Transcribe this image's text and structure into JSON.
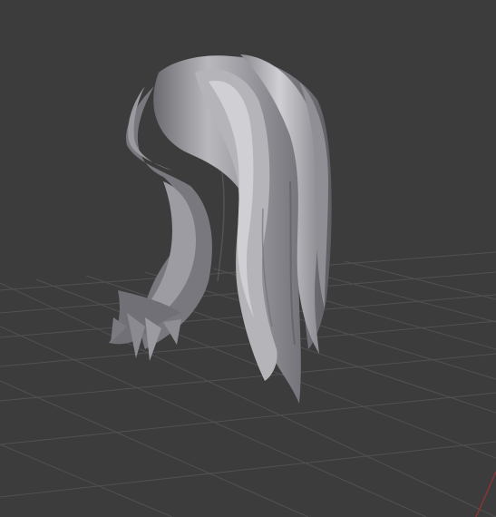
{
  "viewport": {
    "background_color": "#3c3c3c",
    "grid_color": "#505050",
    "axis_color": "#9a3a3a",
    "model_color": "#a6a6ab",
    "model_highlight": "#d2d2d6",
    "model_shadow": "#5d5d63",
    "model": "hair-mesh",
    "shading": "solid"
  }
}
